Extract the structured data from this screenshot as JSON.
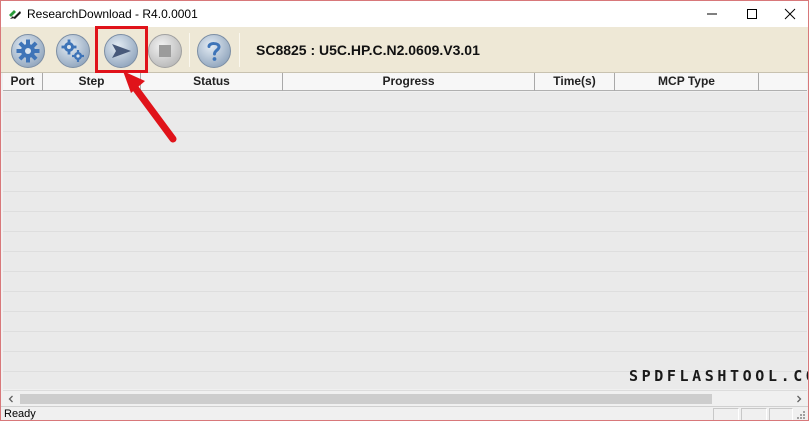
{
  "window": {
    "title": "ResearchDownload - R4.0.0001",
    "minimize_glyph": "—",
    "maximize_glyph": "☐",
    "close_glyph": "✕"
  },
  "toolbar": {
    "buttons": [
      {
        "name": "load-packet",
        "icon": "gear-icon"
      },
      {
        "name": "settings",
        "icon": "double-gear-icon"
      },
      {
        "name": "start-download",
        "icon": "play-arrow-icon"
      },
      {
        "name": "stop-download",
        "icon": "stop-square-icon"
      },
      {
        "name": "help",
        "icon": "question-mark-icon"
      }
    ],
    "firmware_version": "SC8825 : U5C.HP.C.N2.0609.V3.01"
  },
  "grid": {
    "columns": [
      "Port",
      "Step",
      "Status",
      "Progress",
      "Time(s)",
      "MCP Type"
    ],
    "rows": []
  },
  "statusbar": {
    "text": "Ready"
  },
  "watermark": {
    "text": "SPDFLASHTOOL.COM"
  },
  "colors": {
    "toolbar_bg": "#eee8d6",
    "highlight": "#e0131a",
    "window_border": "#d8787a",
    "grid_bg": "#eaeaea"
  }
}
